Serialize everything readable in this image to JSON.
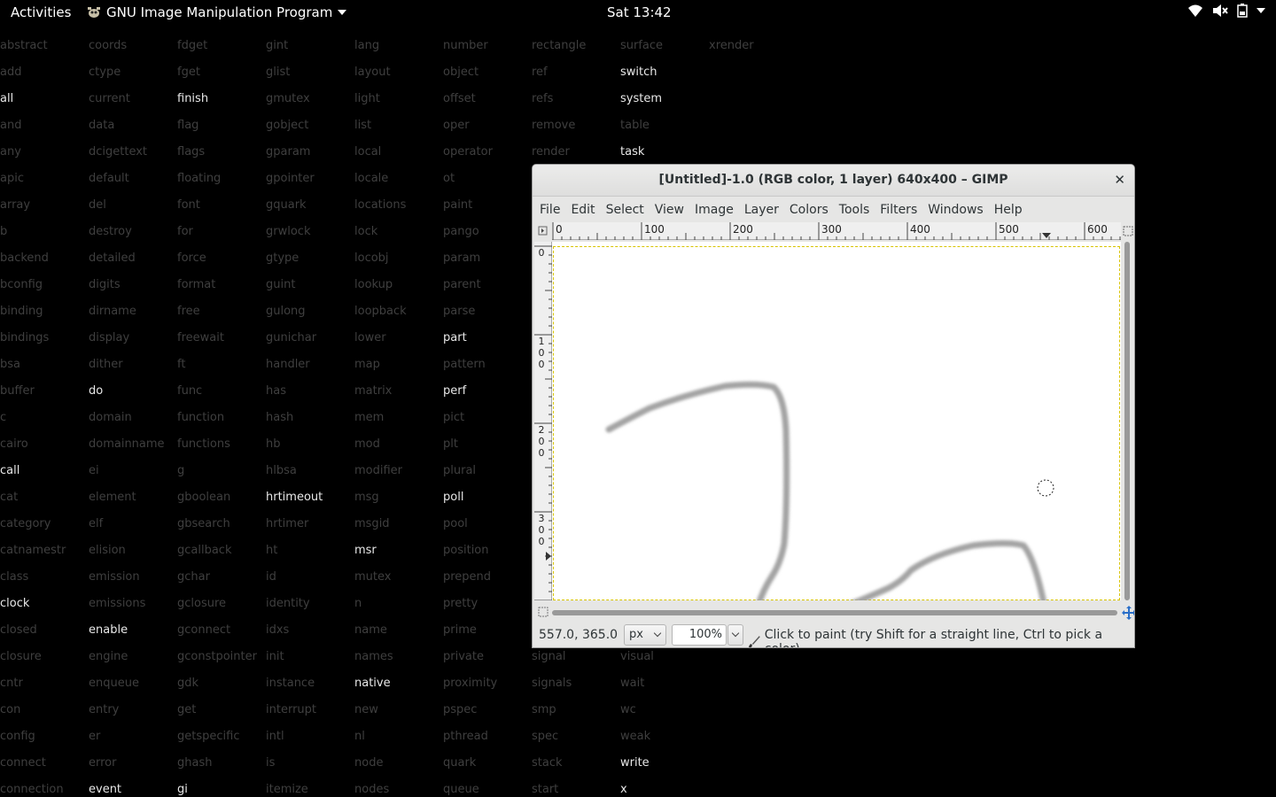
{
  "topbar": {
    "activities": "Activities",
    "app_name": "GNU Image Manipulation Program",
    "clock": "Sat 13:42"
  },
  "background_words": {
    "columns": [
      [
        "abstract",
        "add",
        "all",
        "and",
        "any",
        "apic",
        "array",
        "b",
        "backend",
        "bconfig",
        "binding",
        "bindings",
        "bsa",
        "buffer",
        "c",
        "cairo",
        "call",
        "cat",
        "category",
        "catnamestr",
        "class",
        "clock",
        "closed",
        "closure",
        "cntr",
        "con",
        "config",
        "connect",
        "connection"
      ],
      [
        "coords",
        "ctype",
        "current",
        "data",
        "dcigettext",
        "default",
        "del",
        "destroy",
        "detailed",
        "digits",
        "dirname",
        "display",
        "dither",
        "do",
        "domain",
        "domainname",
        "ei",
        "element",
        "elf",
        "elision",
        "emission",
        "emissions",
        "enable",
        "engine",
        "enqueue",
        "entry",
        "er",
        "error",
        "event"
      ],
      [
        "fdget",
        "fget",
        "finish",
        "flag",
        "flags",
        "floating",
        "font",
        "for",
        "force",
        "format",
        "free",
        "freewait",
        "ft",
        "func",
        "function",
        "functions",
        "g",
        "gboolean",
        "gbsearch",
        "gcallback",
        "gchar",
        "gclosure",
        "gconnect",
        "gconstpointer",
        "gdk",
        "get",
        "getspecific",
        "ghash",
        "gi"
      ],
      [
        "gint",
        "glist",
        "gmutex",
        "gobject",
        "gparam",
        "gpointer",
        "gquark",
        "grwlock",
        "gtype",
        "guint",
        "gulong",
        "gunichar",
        "handler",
        "has",
        "hash",
        "hb",
        "hlbsa",
        "hrtimeout",
        "hrtimer",
        "ht",
        "id",
        "identity",
        "idxs",
        "init",
        "instance",
        "interrupt",
        "intl",
        "is",
        "itemize"
      ],
      [
        "lang",
        "layout",
        "light",
        "list",
        "local",
        "locale",
        "locations",
        "lock",
        "locobj",
        "lookup",
        "loopback",
        "lower",
        "map",
        "matrix",
        "mem",
        "mod",
        "modifier",
        "msg",
        "msgid",
        "msr",
        "mutex",
        "n",
        "name",
        "names",
        "native",
        "new",
        "nl",
        "node",
        "nodes"
      ],
      [
        "number",
        "object",
        "offset",
        "oper",
        "operator",
        "ot",
        "paint",
        "pango",
        "param",
        "parent",
        "parse",
        "part",
        "pattern",
        "perf",
        "pict",
        "plt",
        "plural",
        "poll",
        "pool",
        "position",
        "prepend",
        "pretty",
        "prime",
        "private",
        "proximity",
        "pspec",
        "pthread",
        "quark",
        "queue"
      ],
      [
        "rectangle",
        "ref",
        "refs",
        "remove",
        "render",
        "",
        "",
        "",
        "",
        "",
        "",
        "",
        "",
        "",
        "",
        "",
        "",
        "",
        "",
        "",
        "",
        "",
        "",
        "signal",
        "signals",
        "smp",
        "spec",
        "stack",
        "start"
      ],
      [
        "surface",
        "switch",
        "system",
        "table",
        "task",
        "",
        "",
        "",
        "",
        "",
        "",
        "",
        "",
        "",
        "",
        "",
        "",
        "",
        "",
        "",
        "",
        "",
        "",
        "visual",
        "wait",
        "wc",
        "weak",
        "write",
        "x"
      ],
      [
        "xrender"
      ]
    ],
    "bright": [
      "all",
      "finish",
      "switch",
      "system",
      "task",
      "part",
      "perf",
      "do",
      "call",
      "poll",
      "hrtimeout",
      "msr",
      "clock",
      "enable",
      "native",
      "write",
      "event",
      "gi",
      "x"
    ]
  },
  "gimp": {
    "title": "[Untitled]-1.0 (RGB color, 1 layer) 640x400 – GIMP",
    "menu": [
      "File",
      "Edit",
      "Select",
      "View",
      "Image",
      "Layer",
      "Colors",
      "Tools",
      "Filters",
      "Windows",
      "Help"
    ],
    "ruler_h_labels": [
      "0",
      "100",
      "200",
      "300",
      "400",
      "500",
      "600"
    ],
    "ruler_v_labels": [
      [
        "0"
      ],
      [
        "1",
        "0",
        "0"
      ],
      [
        "2",
        "0",
        "0"
      ],
      [
        "3",
        "0",
        "0"
      ]
    ],
    "status": {
      "coords": "557.0, 365.0",
      "unit": "px",
      "zoom": "100%",
      "hint": "Click to paint (try Shift for a straight line, Ctrl to pick a color)"
    }
  }
}
